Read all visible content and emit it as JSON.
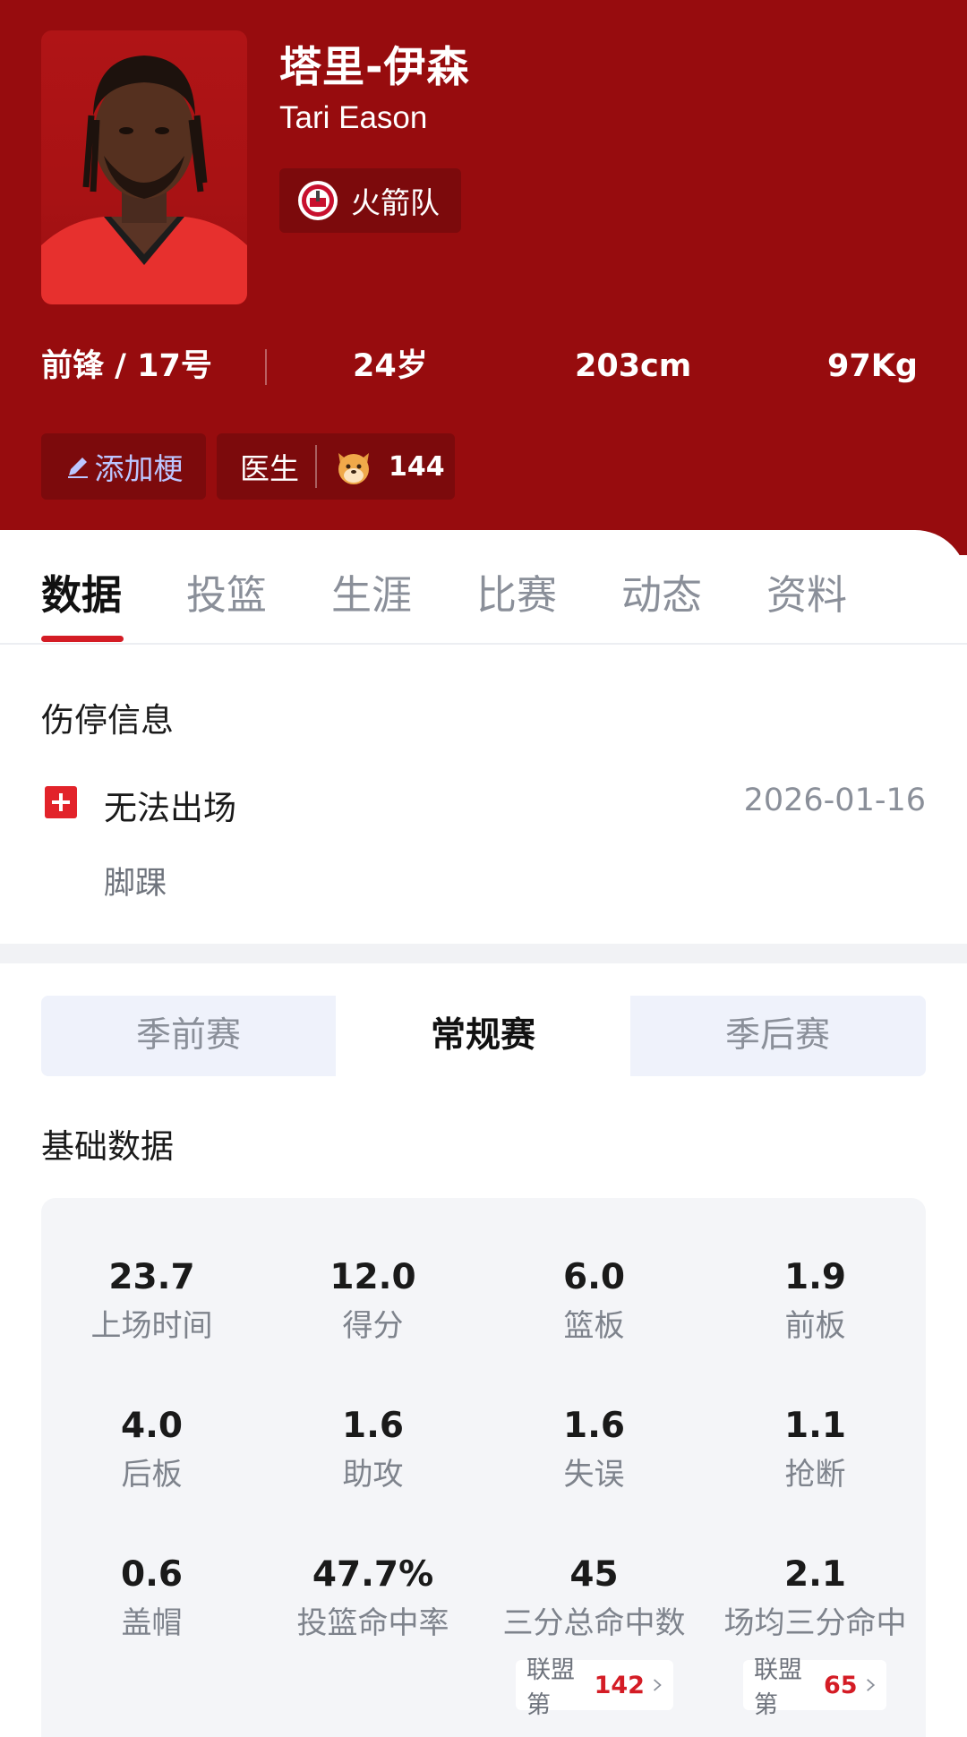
{
  "player": {
    "name_cn": "塔里-伊森",
    "name_en": "Tari Eason",
    "team": "火箭队",
    "position_number": "前锋 / 17号",
    "age": "24岁",
    "height": "203cm",
    "weight": "97Kg"
  },
  "actions": {
    "add_meme_label": "添加梗",
    "doctor_label": "医生",
    "doctor_count": "144"
  },
  "tabs": [
    {
      "label": "数据"
    },
    {
      "label": "投篮"
    },
    {
      "label": "生涯"
    },
    {
      "label": "比赛"
    },
    {
      "label": "动态"
    },
    {
      "label": "资料"
    }
  ],
  "active_tab": "数据",
  "injury": {
    "title": "伤停信息",
    "status": "无法出场",
    "date": "2026-01-16",
    "body_part": "脚踝"
  },
  "season_switch": [
    {
      "label": "季前赛"
    },
    {
      "label": "常规赛"
    },
    {
      "label": "季后赛"
    }
  ],
  "active_season": "常规赛",
  "basic_stats": {
    "title": "基础数据",
    "items": [
      {
        "value": "23.7",
        "label": "上场时间"
      },
      {
        "value": "12.0",
        "label": "得分"
      },
      {
        "value": "6.0",
        "label": "篮板"
      },
      {
        "value": "1.9",
        "label": "前板"
      },
      {
        "value": "4.0",
        "label": "后板"
      },
      {
        "value": "1.6",
        "label": "助攻"
      },
      {
        "value": "1.6",
        "label": "失误"
      },
      {
        "value": "1.1",
        "label": "抢断"
      },
      {
        "value": "0.6",
        "label": "盖帽"
      },
      {
        "value": "47.7%",
        "label": "投篮命中率"
      },
      {
        "value": "45",
        "label": "三分总命中数"
      },
      {
        "value": "2.1",
        "label": "场均三分命中"
      }
    ],
    "ranks": [
      {
        "prefix": "联盟第",
        "rank": "142"
      },
      {
        "prefix": "联盟第",
        "rank": "65"
      }
    ]
  },
  "colors": {
    "header_bg": "#970c0e",
    "chip_bg": "#7c0a0c",
    "accent_red": "#d41c25",
    "meme_text": "#bcc6ff"
  }
}
